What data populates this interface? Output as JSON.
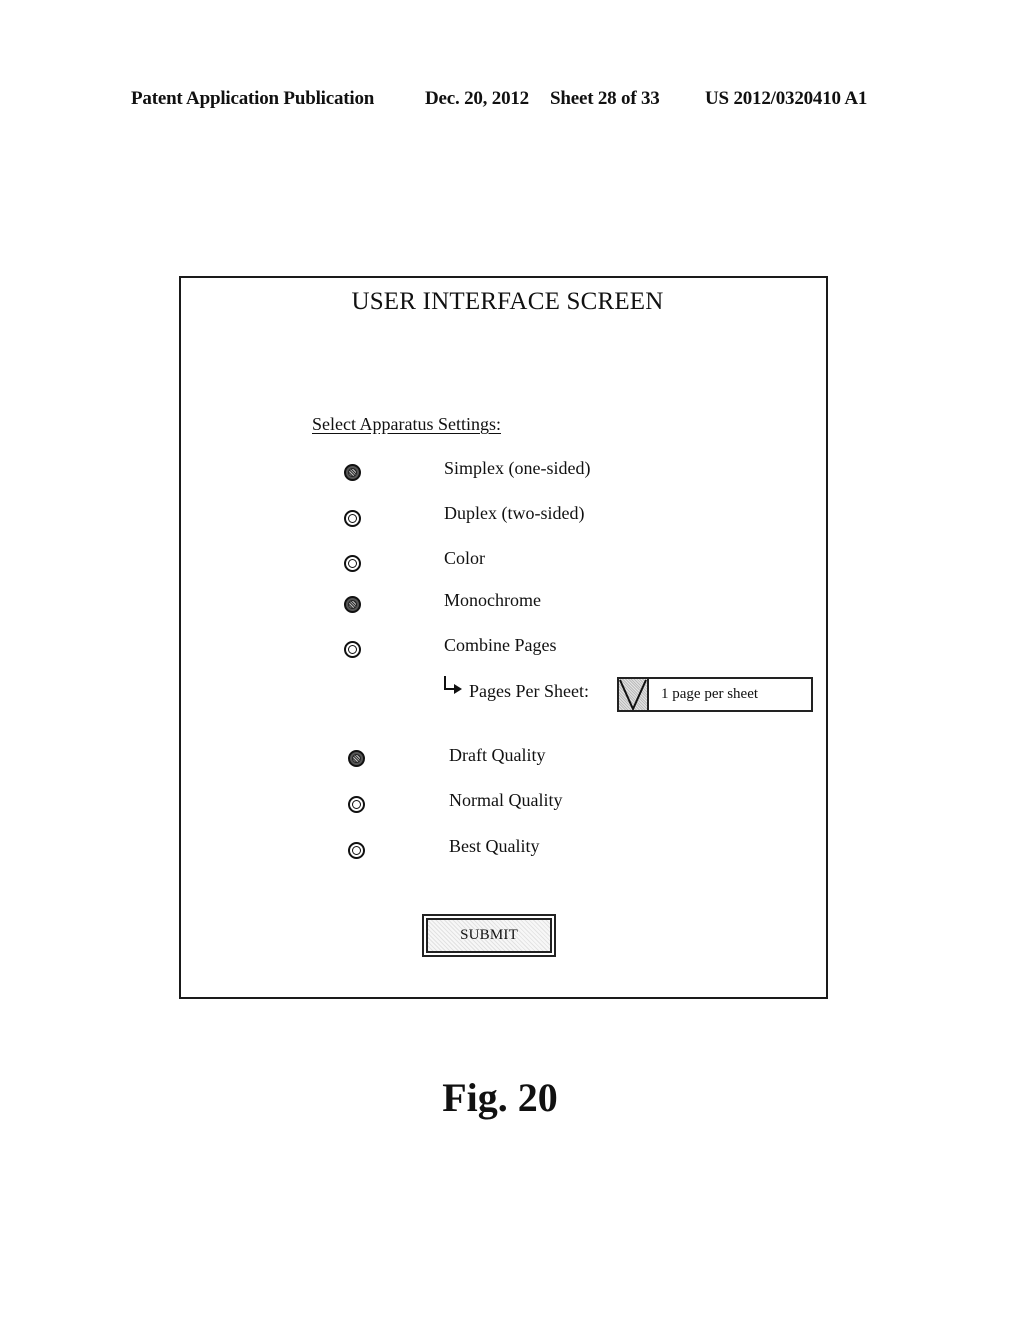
{
  "header": {
    "publication": "Patent Application Publication",
    "date": "Dec. 20, 2012",
    "sheet": "Sheet 28 of 33",
    "number": "US 2012/0320410 A1"
  },
  "screen": {
    "title": "USER INTERFACE SCREEN",
    "section_label": "Select Apparatus Settings:",
    "options": [
      {
        "label": "Simplex (one-sided)",
        "selected": true
      },
      {
        "label": "Duplex (two-sided)",
        "selected": false
      },
      {
        "label": "Color",
        "selected": false
      },
      {
        "label": "Monochrome",
        "selected": true
      },
      {
        "label": "Combine Pages",
        "selected": false
      }
    ],
    "pages_per_sheet": {
      "label": "Pages Per Sheet:",
      "selected_value": "1 page per sheet",
      "arrow_icon": "return-arrow-icon",
      "dropdown_icon": "chevron-down-icon"
    },
    "quality_options": [
      {
        "label": "Draft Quality",
        "selected": true
      },
      {
        "label": "Normal Quality",
        "selected": false
      },
      {
        "label": "Best Quality",
        "selected": false
      }
    ],
    "submit_label": "SUBMIT"
  },
  "figure": {
    "caption": "Fig. 20"
  }
}
